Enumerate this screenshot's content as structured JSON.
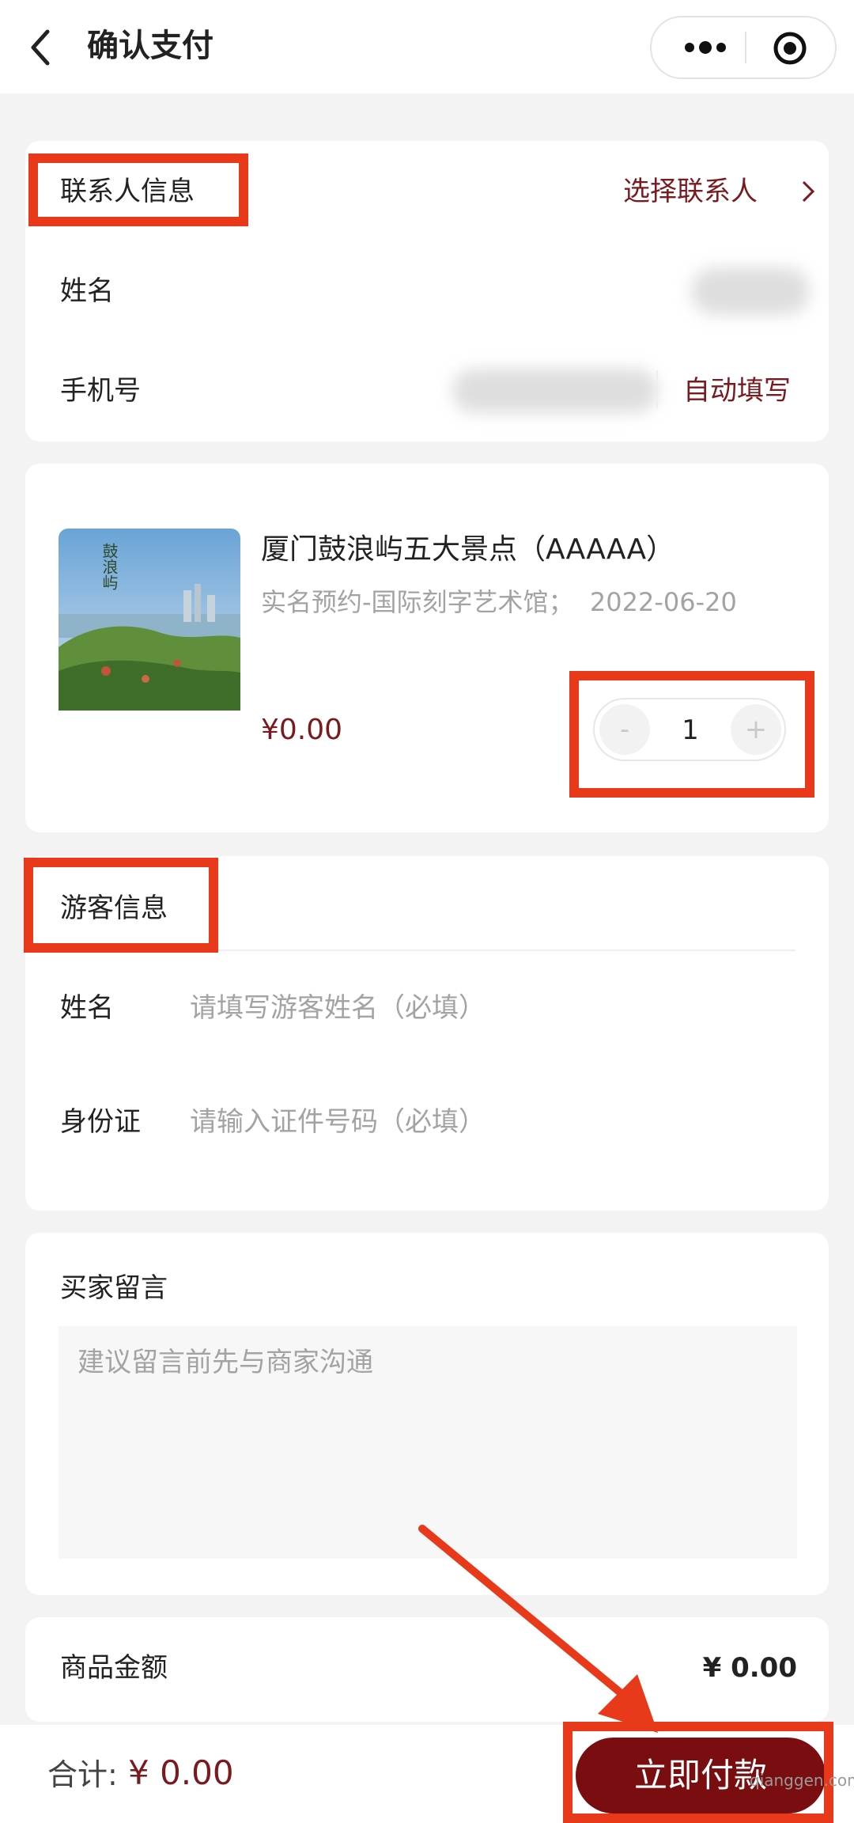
{
  "header": {
    "title": "确认支付"
  },
  "contact": {
    "section_title": "联系人信息",
    "select_label": "选择联系人",
    "name_label": "姓名",
    "phone_label": "手机号",
    "autofill_label": "自动填写"
  },
  "product": {
    "image_caption": "鼓浪屿",
    "name": "厦门鼓浪屿五大景点（AAAAA）",
    "spec": "实名预约-国际刻字艺术馆；  2022-06-20",
    "price": "¥0.00",
    "quantity": "1",
    "minus": "-",
    "plus": "+"
  },
  "visitor": {
    "section_title": "游客信息",
    "name_label": "姓名",
    "name_placeholder": "请填写游客姓名（必填）",
    "id_label": "身份证",
    "id_placeholder": "请输入证件号码（必填）"
  },
  "message": {
    "title": "买家留言",
    "placeholder": "建议留言前先与商家沟通"
  },
  "amount": {
    "label": "商品金额",
    "value": "¥ 0.00"
  },
  "footer": {
    "total_label": "合计:",
    "total_value": "¥ 0.00",
    "pay_label": "立即付款"
  },
  "watermark": "qianggen.com",
  "colors": {
    "accent": "#7a0d10",
    "annotation": "#e83a1a"
  }
}
